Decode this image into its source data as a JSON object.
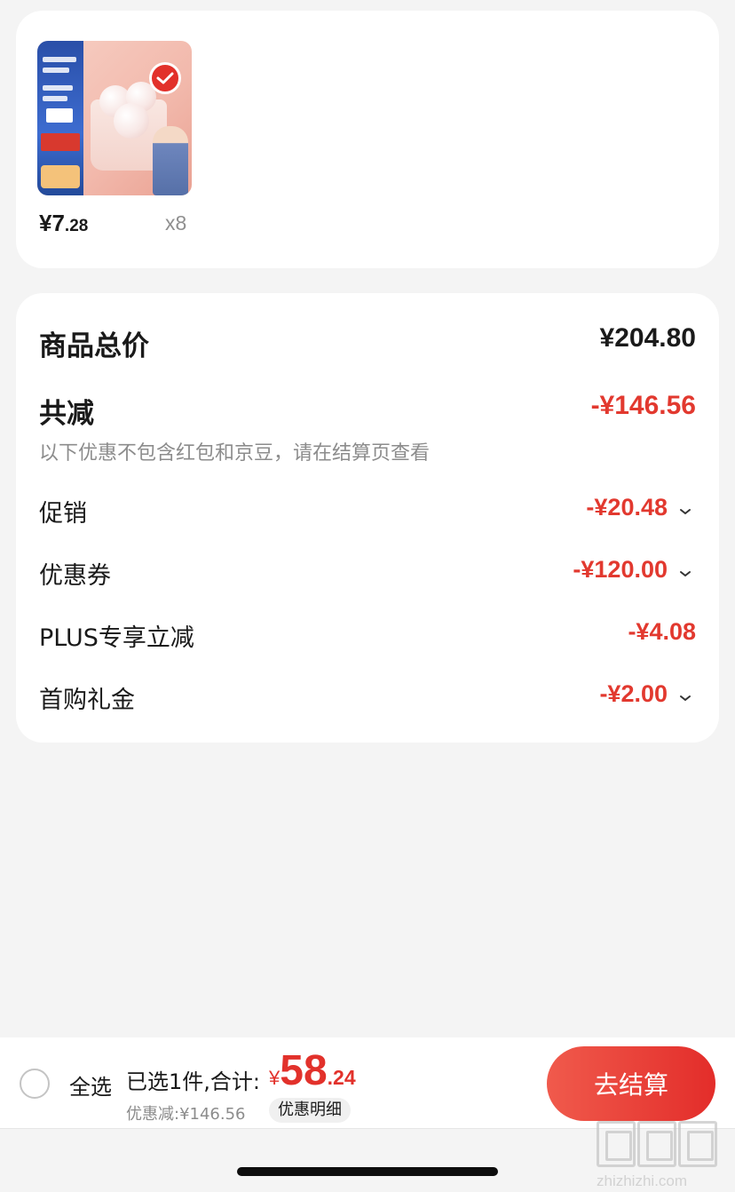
{
  "product": {
    "price_integer": "¥7",
    "price_decimal": ".28",
    "quantity": "x8",
    "selected": true
  },
  "summary": {
    "total_label": "商品总价",
    "total_value": "¥204.80",
    "reduction_label": "共减",
    "reduction_value": "-¥146.56",
    "note": "以下优惠不包含红包和京豆，请在结算页查看",
    "items": [
      {
        "label": "促销",
        "value": "-¥20.48",
        "expandable": true
      },
      {
        "label": "优惠券",
        "value": "-¥120.00",
        "expandable": true
      },
      {
        "label": "PLUS专享立减",
        "value": "-¥4.08",
        "expandable": false
      },
      {
        "label": "首购礼金",
        "value": "-¥2.00",
        "expandable": true
      }
    ]
  },
  "bottom_bar": {
    "select_all_label": "全选",
    "selected_text": "已选1件,合计:",
    "total_currency": "¥",
    "total_integer": "58",
    "total_decimal": ".24",
    "discount_text": "优惠减:¥146.56",
    "discount_detail_label": "优惠明细",
    "checkout_label": "去结算"
  },
  "watermark": {
    "text": "zhizhizhi.com"
  },
  "colors": {
    "accent_red": "#e2312b",
    "discount_red": "#e2392f",
    "background": "#f4f4f4",
    "muted_text": "#8c8c8c"
  },
  "icons": {
    "check": "check-icon",
    "chevron": "chevron-down-icon",
    "radio": "radio-unchecked-icon"
  }
}
